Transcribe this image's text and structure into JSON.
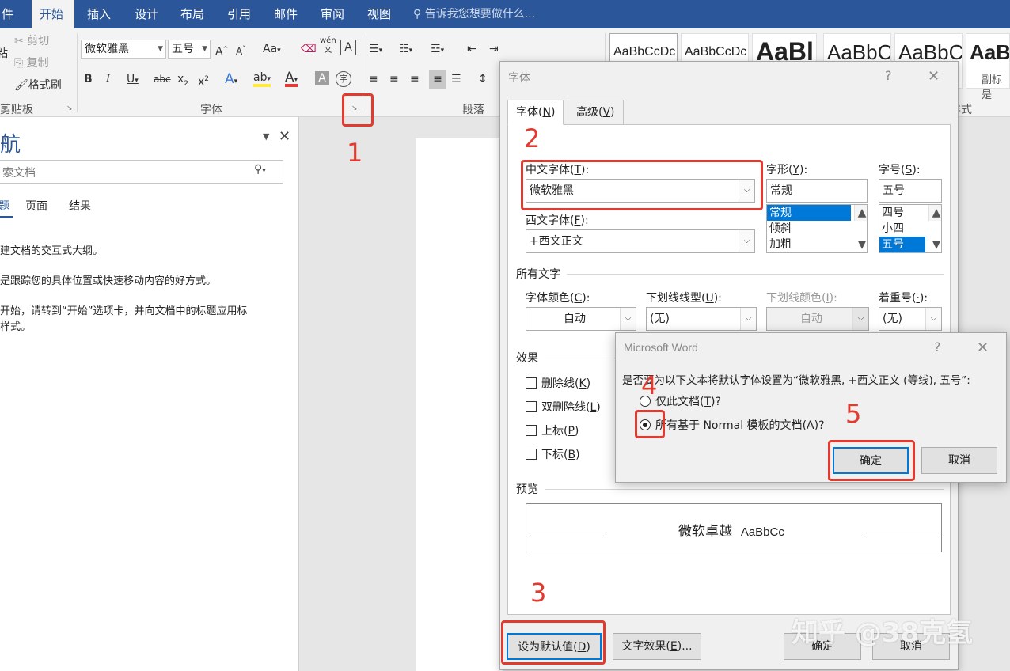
{
  "tabs": [
    "件",
    "开始",
    "插入",
    "设计",
    "布局",
    "引用",
    "邮件",
    "审阅",
    "视图"
  ],
  "tellme": "告诉我您想要做什么...",
  "ribbon": {
    "clipboard": {
      "cut": "剪切",
      "copy": "复制",
      "painter": "格式刷",
      "paste": "粘",
      "label": "剪贴板"
    },
    "font": {
      "name": "微软雅黑",
      "size": "五号",
      "aa": "Aa",
      "wen": "wén",
      "label": "字体"
    },
    "paragraph": {
      "label": "段落"
    },
    "styles": {
      "samples": [
        "AaBbCcDc",
        "AaBbCcDc",
        "AaBl",
        "AaBbC",
        "AaBbC",
        "AaBl"
      ],
      "sublabel": "副标是",
      "label": "样式"
    }
  },
  "nav": {
    "title": "航",
    "search_placeholder": "索文档",
    "tabs": [
      "题",
      "页面",
      "结果"
    ],
    "lines": [
      "建文档的交互式大纲。",
      "是跟踪您的具体位置或快速移动内容的好方式。",
      "开始，请转到“开始”选项卡，并向文档中的标题应用标",
      "样式。"
    ]
  },
  "fontdlg": {
    "title": "字体",
    "help": "?",
    "close": "✕",
    "tabs": [
      {
        "label": "字体",
        "key": "N"
      },
      {
        "label": "高级",
        "key": "V"
      }
    ],
    "cn_font_label": "中文字体",
    "cn_font_key": "T",
    "cn_font": "微软雅黑",
    "west_font_label": "西文字体",
    "west_font_key": "F",
    "west_font": "+西文正文",
    "style_label": "字形",
    "style_key": "Y",
    "style_value": "常规",
    "style_list": [
      "常规",
      "倾斜",
      "加粗"
    ],
    "size_label": "字号",
    "size_key": "S",
    "size_value": "五号",
    "size_list": [
      "四号",
      "小四",
      "五号"
    ],
    "all_text": "所有文字",
    "color_label": "字体颜色",
    "color_key": "C",
    "color_value": "自动",
    "underline_label": "下划线线型",
    "underline_key": "U",
    "underline_value": "(无)",
    "ucolor_label": "下划线颜色",
    "ucolor_key": "I",
    "ucolor_value": "自动",
    "emph_label": "着重号",
    "emph_key": "·",
    "emph_value": "(无)",
    "effects": "效果",
    "checks": [
      {
        "label": "删除线",
        "key": "K"
      },
      {
        "label": "双删除线",
        "key": "L"
      },
      {
        "label": "上标",
        "key": "P"
      },
      {
        "label": "下标",
        "key": "B"
      }
    ],
    "preview_label": "预览",
    "preview_cn": "微软卓越",
    "preview_en": "AaBbCc",
    "btn_default": "设为默认值",
    "btn_default_key": "D",
    "btn_effects": "文字效果",
    "btn_effects_key": "E",
    "btn_ok": "确定",
    "btn_cancel": "取消"
  },
  "msgdlg": {
    "title": "Microsoft Word",
    "help": "?",
    "close": "✕",
    "question": "是否要为以下文本将默认字体设置为“微软雅黑, +西文正文 (等线), 五号”:",
    "opt1": "仅此文档",
    "opt1_key": "T",
    "opt2": "所有基于 Normal 模板的文档",
    "opt2_key": "A",
    "ok": "确定",
    "cancel": "取消"
  },
  "annotations": [
    "1",
    "2",
    "3",
    "4",
    "5"
  ],
  "watermark": "知乎 @38克氢",
  "colors": {
    "accent": "#2b579a",
    "annotation": "#e23a2f",
    "selection": "#0078d7"
  }
}
